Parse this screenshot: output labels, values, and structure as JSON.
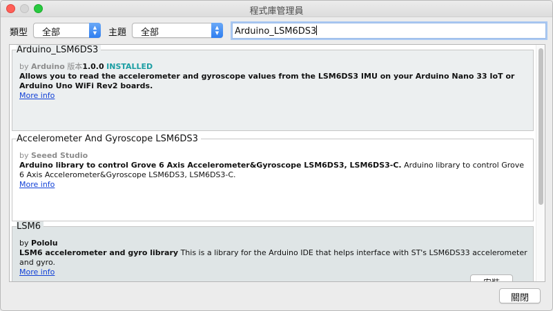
{
  "window": {
    "title": "程式庫管理員"
  },
  "filters": {
    "type_label": "類型",
    "type_value": "全部",
    "topic_label": "主題",
    "topic_value": "全部"
  },
  "search": {
    "value": "Arduino_LSM6DS3"
  },
  "libraries": [
    {
      "name": "Arduino_LSM6DS3",
      "by": "by",
      "author": "Arduino",
      "version_prefix": "版本",
      "version": "1.0.0",
      "status": "INSTALLED",
      "description_bold": "Allows you to read the accelerometer and gyroscope values from the LSM6DS3 IMU on your Arduino Nano 33 IoT or Arduino Uno WiFi Rev2 boards.",
      "description": "",
      "more_info": "More info"
    },
    {
      "name": "Accelerometer And Gyroscope LSM6DS3",
      "by": "by",
      "author": "Seeed Studio",
      "description_bold": "Arduino library to control Grove 6 Axis Accelerometer&Gyroscope LSM6DS3, LSM6DS3-C.",
      "description": "Arduino library to control Grove 6 Axis Accelerometer&Gyroscope LSM6DS3, LSM6DS3-C.",
      "more_info": "More info"
    },
    {
      "name": "LSM6",
      "by": "by",
      "author": "Pololu",
      "description_bold": "LSM6 accelerometer and gyro library",
      "description": "This is a library for the Arduino IDE that helps interface with ST's LSM6DS33 accelerometer and gyro.",
      "more_info": "More info",
      "install_label": "安裝"
    }
  ],
  "footer": {
    "close_label": "關閉"
  },
  "colors": {
    "installed": "#1b9ea3",
    "link": "#0f3fd6",
    "select_accent": "#2f7ef0"
  }
}
